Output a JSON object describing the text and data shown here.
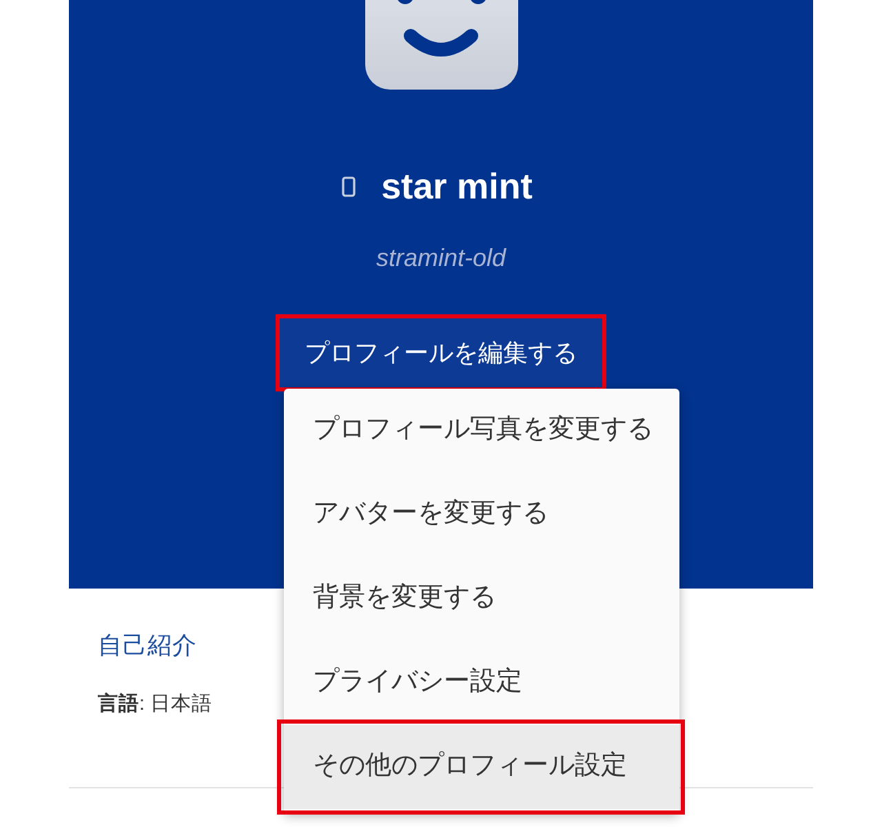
{
  "profile": {
    "display_name": "star mint",
    "username": "stramint-old"
  },
  "edit_button": {
    "label": "プロフィールを編集する",
    "highlighted": true
  },
  "dropdown_menu": {
    "items": [
      {
        "label": "プロフィール写真を変更する",
        "selected": false,
        "highlighted": false
      },
      {
        "label": "アバターを変更する",
        "selected": false,
        "highlighted": false
      },
      {
        "label": "背景を変更する",
        "selected": false,
        "highlighted": false
      },
      {
        "label": "プライバシー設定",
        "selected": false,
        "highlighted": false
      },
      {
        "label": "その他のプロフィール設定",
        "selected": true,
        "highlighted": true
      }
    ]
  },
  "about": {
    "heading": "自己紹介",
    "language": "**言語**: 日本語"
  }
}
